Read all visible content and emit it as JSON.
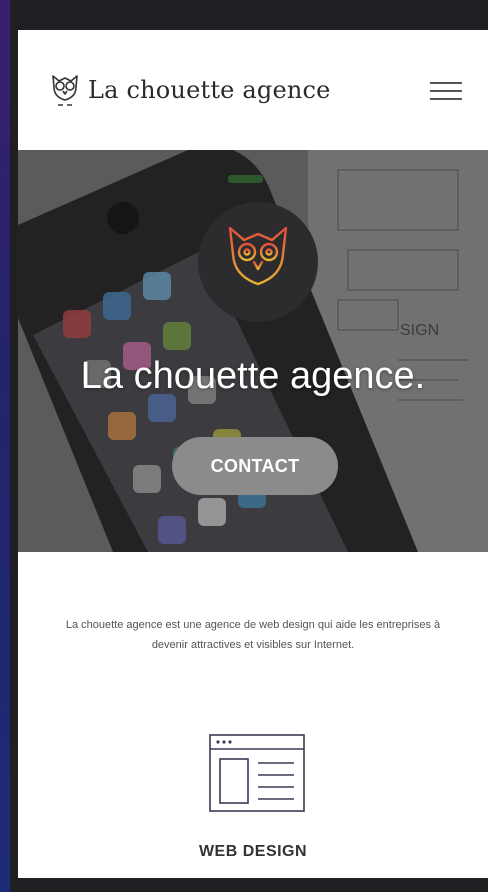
{
  "header": {
    "brand_name": "La chouette agence",
    "logo_icon": "owl-icon",
    "menu_icon": "hamburger-menu-icon"
  },
  "hero": {
    "title": "La chouette agence.",
    "contact_label": "CONTACT",
    "badge_icon": "owl-icon"
  },
  "intro": {
    "text": "La chouette agence est une agence de web design qui aide les entreprises à devenir attractives et visibles sur Internet."
  },
  "services": [
    {
      "title": "WEB DESIGN",
      "icon": "web-browser-layout-icon"
    }
  ],
  "colors": {
    "owl_gradient_top": "#e0503a",
    "owl_gradient_bottom": "#e8b330",
    "contact_bg": "#8b8b8b",
    "hero_owl_bg": "#2c2c2e"
  }
}
